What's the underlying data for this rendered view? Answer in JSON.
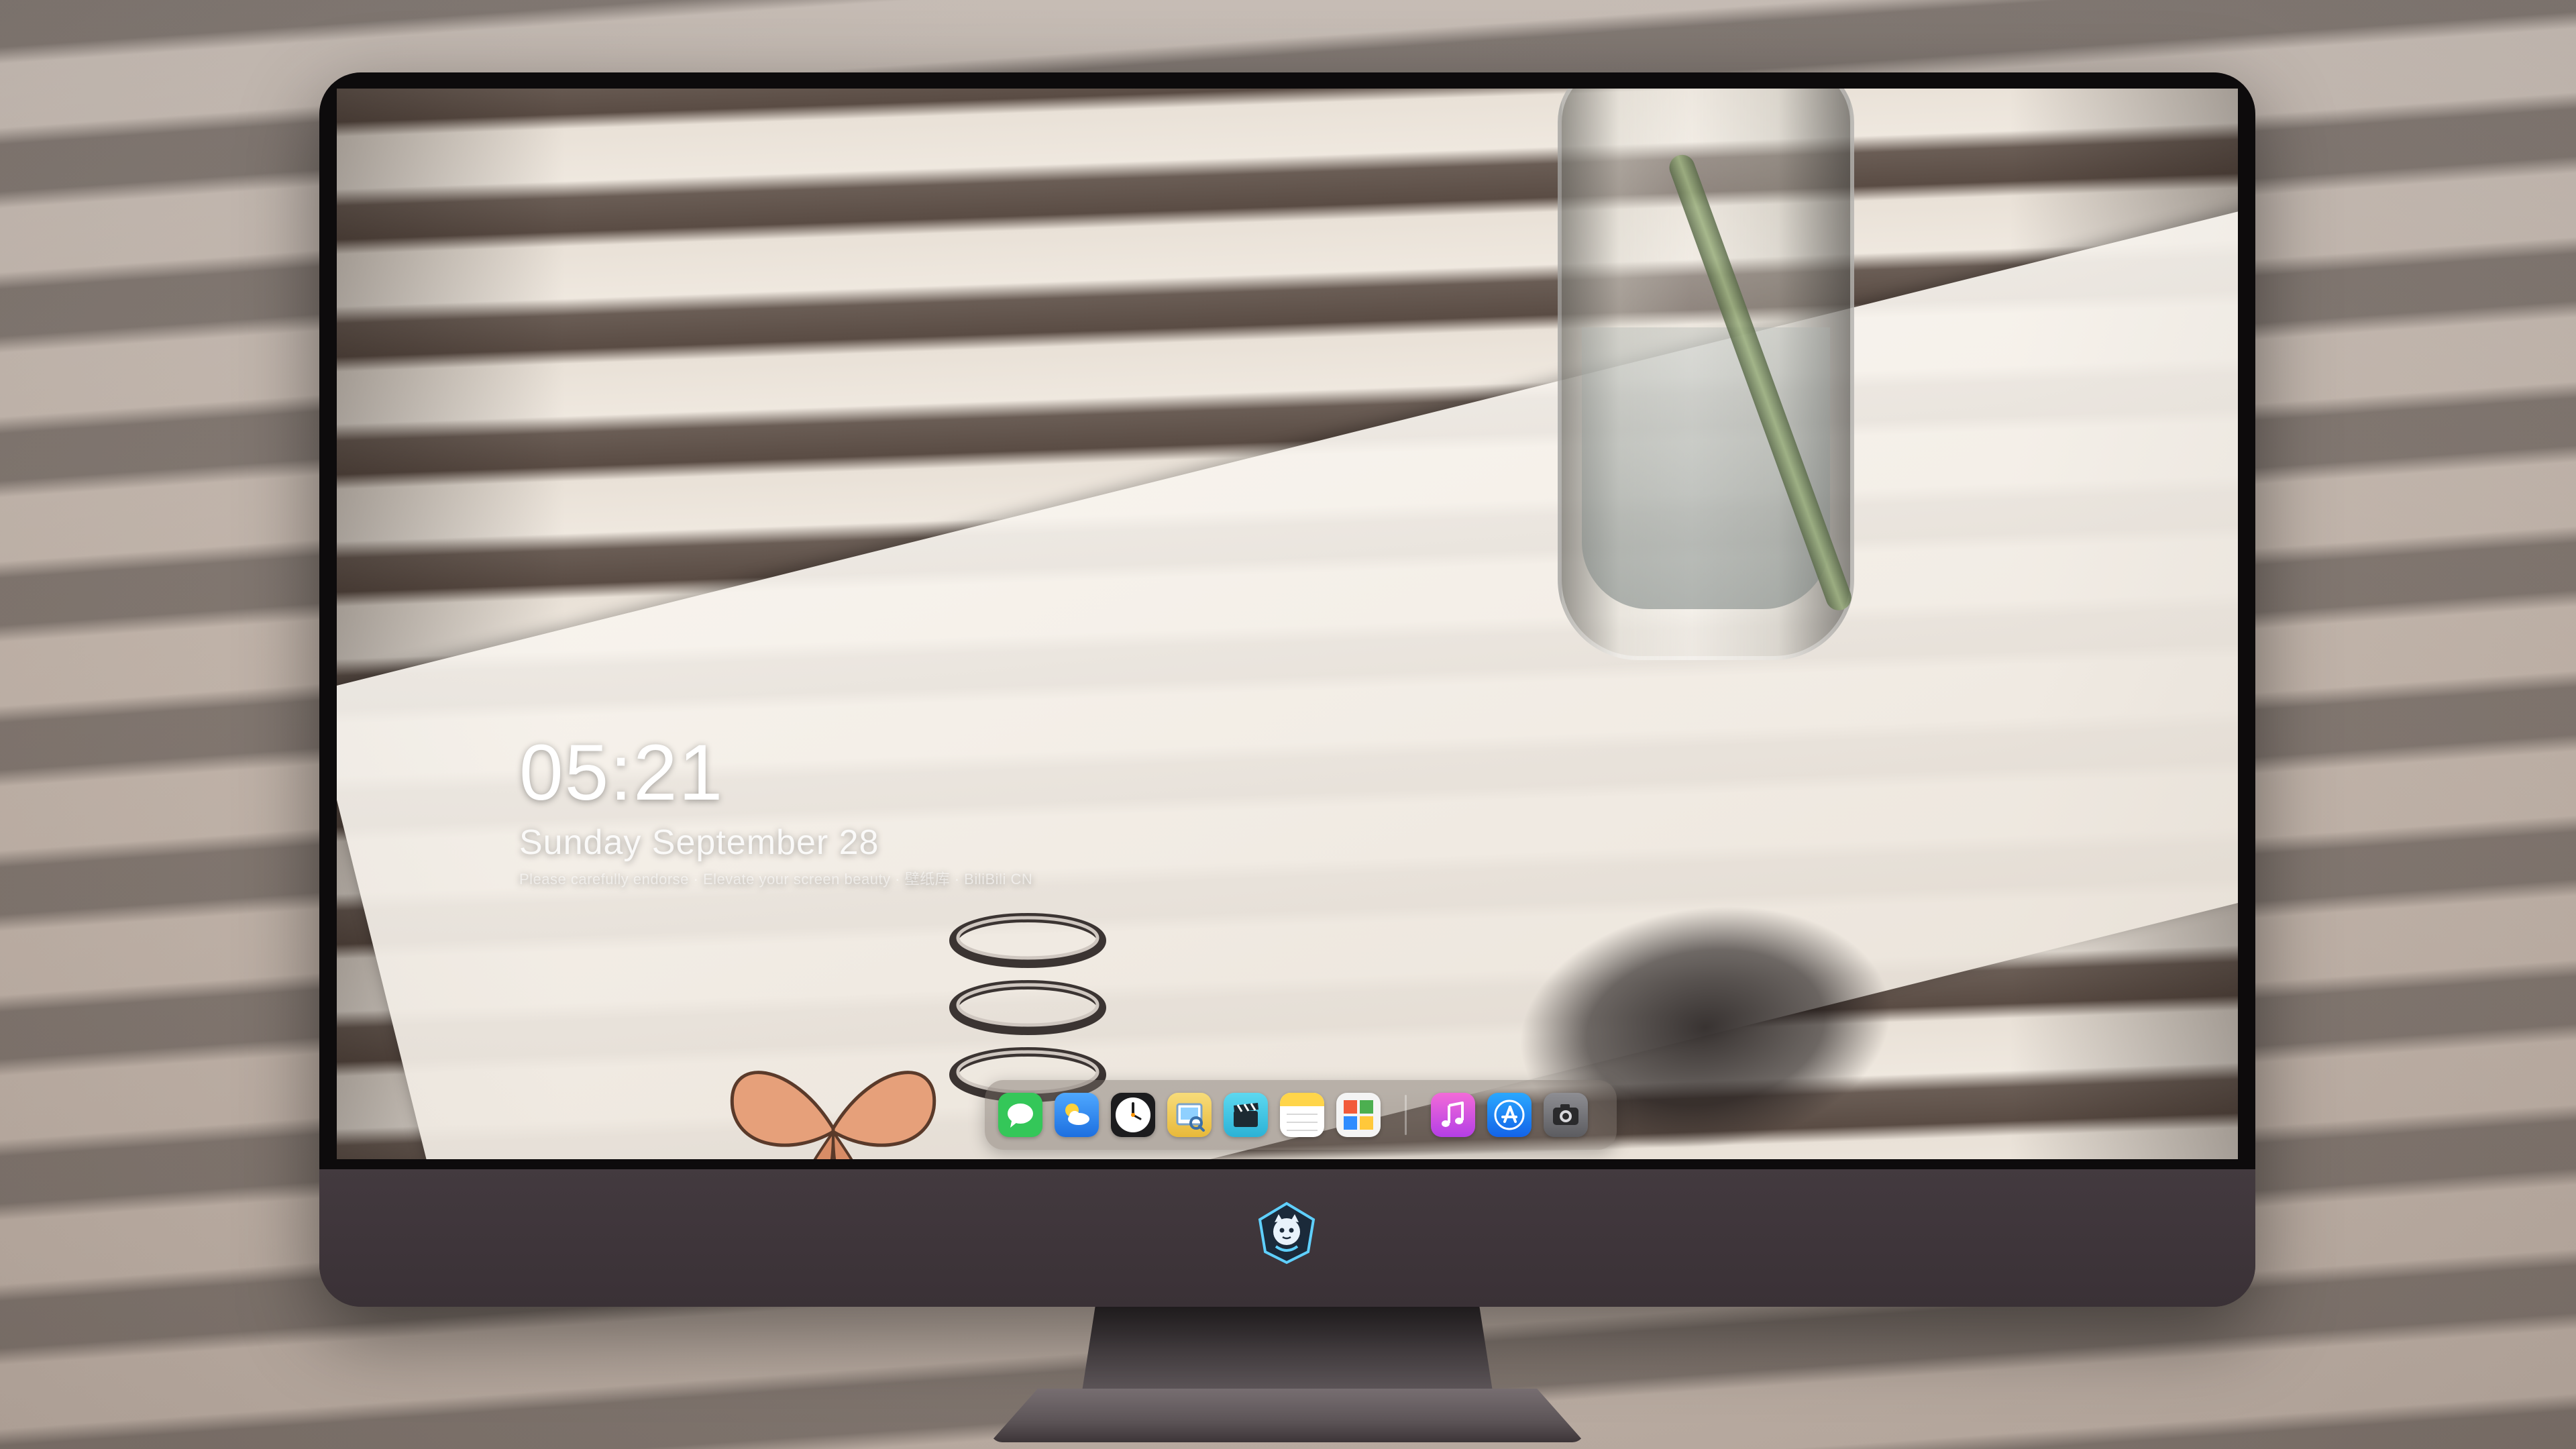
{
  "lockscreen": {
    "time": "05:21",
    "date": "Sunday  September  28",
    "tagline": "Please  carefully  endorse  ·  Elevate your screen beauty  ·  壁纸库  ·  BiliBili CN"
  },
  "dock": {
    "apps": [
      {
        "name": "Messages",
        "icon": "messages-icon",
        "color": "#34c759"
      },
      {
        "name": "Weather",
        "icon": "weather-icon",
        "color": "#2f8cff"
      },
      {
        "name": "Clock",
        "icon": "clock-icon",
        "color": "#1c1c1e"
      },
      {
        "name": "Preview",
        "icon": "preview-icon",
        "color": "#f2c14e"
      },
      {
        "name": "Clips",
        "icon": "clapperboard-icon",
        "color": "#3cc8e6"
      },
      {
        "name": "Notes",
        "icon": "notes-icon",
        "color": "#ffd54a"
      },
      {
        "name": "Photos",
        "icon": "photos-icon",
        "color": "#f0f0f0"
      },
      {
        "name": "iTunes",
        "icon": "music-note-icon",
        "color": "#e94bd4"
      },
      {
        "name": "App Store",
        "icon": "app-store-icon",
        "color": "#1e90ff"
      },
      {
        "name": "Camera",
        "icon": "camera-icon",
        "color": "#6c6c70"
      }
    ]
  },
  "monitor": {
    "logo": "mascot-logo-icon"
  }
}
